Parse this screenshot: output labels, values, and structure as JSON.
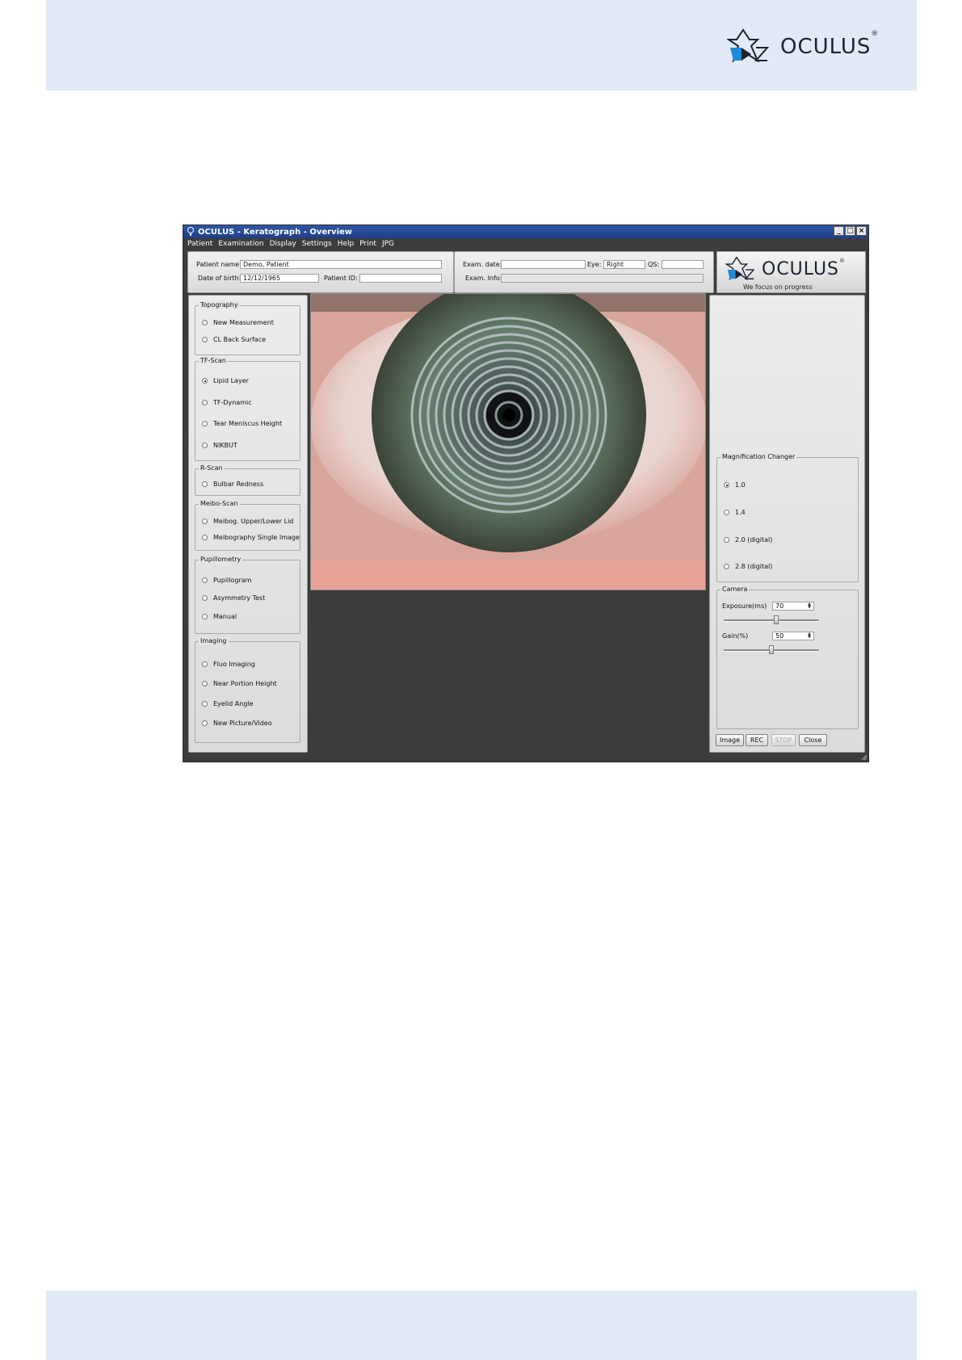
{
  "page": {
    "brand_name": "OCULUS",
    "brand_mark": "®"
  },
  "window": {
    "title": "OCULUS - Keratograph - Overview",
    "controls": {
      "minimize": "_",
      "maximize": "□",
      "close": "×"
    }
  },
  "menu": [
    "Patient",
    "Examination",
    "Display",
    "Settings",
    "Help",
    "Print",
    "JPG"
  ],
  "patient": {
    "name_label": "Patient name:",
    "name_value": "Demo, Patient",
    "dob_label": "Date of birth:",
    "dob_value": "12/12/1965",
    "id_label": "Patient ID:",
    "id_value": ""
  },
  "exam": {
    "date_label": "Exam. date:",
    "date_value": "",
    "eye_label": "Eye:",
    "eye_value": "Right",
    "qs_label": "QS:",
    "qs_value": "",
    "info_label": "Exam. Info:",
    "info_value": ""
  },
  "logo": {
    "name": "OCULUS",
    "mark": "®",
    "tagline": "We focus on progress"
  },
  "sidebar": {
    "topography": {
      "title": "Topography",
      "options": [
        "New Measurement",
        "CL Back Surface"
      ]
    },
    "tf_scan": {
      "title": "TF-Scan",
      "options": [
        "Lipid Layer",
        "TF-Dynamic",
        "Tear Meniscus Height",
        "NIKBUT"
      ],
      "selected": "Lipid Layer"
    },
    "r_scan": {
      "title": "R-Scan",
      "options": [
        "Bulbar Redness"
      ]
    },
    "meibo_scan": {
      "title": "Meibo-Scan",
      "options": [
        "Meibog. Upper/Lower Lid",
        "Meibography Single Image"
      ]
    },
    "pupillometry": {
      "title": "Pupillometry",
      "options": [
        "Pupillogram",
        "Asymmetry Test",
        "Manual"
      ]
    },
    "imaging": {
      "title": "Imaging",
      "options": [
        "Fluo Imaging",
        "Near Portion Height",
        "Eyelid Angle",
        "New Picture/Video"
      ]
    }
  },
  "magnification": {
    "title": "Magnification Changer",
    "options": [
      "1.0",
      "1.4",
      "2.0 (digital)",
      "2.8 (digital)"
    ],
    "selected": "1.0"
  },
  "camera": {
    "title": "Camera",
    "exposure_label": "Exposure(ms)",
    "exposure_value": "70",
    "exposure_level": 0.55,
    "gain_label": "Gain(%)",
    "gain_value": "50",
    "gain_level": 0.5
  },
  "buttons": {
    "image": "Image",
    "rec": "REC",
    "stop": "STOP",
    "close": "Close"
  },
  "colors": {
    "page_band": "#e1eaf6",
    "window_bg": "#3c3c3c",
    "titlebar": "#2a4d9a",
    "logo_blue": "#1f8ad8",
    "logo_dark": "#1b2330"
  }
}
